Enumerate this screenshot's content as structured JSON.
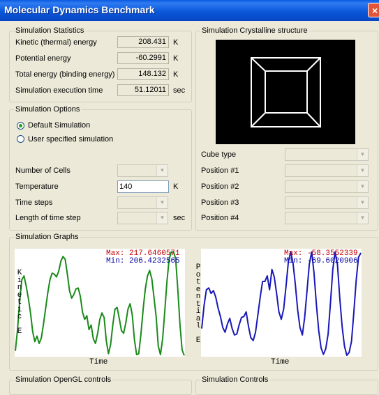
{
  "window": {
    "title": "Molecular Dynamics Benchmark",
    "close_glyph": "×"
  },
  "stats": {
    "legend": "Simulation Statistics",
    "rows": [
      {
        "label": "Kinetic (thermal) energy",
        "value": "208.431",
        "unit": "K"
      },
      {
        "label": "Potential energy",
        "value": "-60.2991",
        "unit": "K"
      },
      {
        "label": "Total energy (binding energy)",
        "value": "148.132",
        "unit": "K"
      },
      {
        "label": "Simulation execution time",
        "value": "51.12011",
        "unit": "sec"
      }
    ]
  },
  "options": {
    "legend": "Simulation Options",
    "default_label": "Default Simulation",
    "user_label": "User specified simulation",
    "cells_label": "Number of Cells",
    "temperature_label": "Temperature",
    "temperature_value": "140",
    "temperature_unit": "K",
    "timesteps_label": "Time steps",
    "length_label": "Length of time step",
    "length_unit": "sec"
  },
  "crystal": {
    "legend": "Simulation Crystalline structure",
    "fields": [
      "Cube type",
      "Position #1",
      "Position #2",
      "Position #3",
      "Position #4"
    ]
  },
  "graphs": {
    "legend": "Simulation Graphs",
    "kinetic": {
      "ylabel": [
        "K",
        "i",
        "n",
        "e",
        "t",
        "i",
        "c",
        "",
        "E"
      ],
      "xlabel": "Time",
      "max_text": "Max: 217.6460571",
      "min_text": "Min: 206.4232565",
      "max": 217.6460571,
      "min": 206.4232565,
      "color": "#1a8a1a",
      "values": [
        206.9,
        209.2,
        212.3,
        214.6,
        215.0,
        213.9,
        212.6,
        211.0,
        209.0,
        207.9,
        208.5,
        207.7,
        208.3,
        209.8,
        211.5,
        213.2,
        214.6,
        215.3,
        215.2,
        214.9,
        215.5,
        216.6,
        217.1,
        216.8,
        215.2,
        213.4,
        212.6,
        213.0,
        213.6,
        213.7,
        212.8,
        211.1,
        210.3,
        210.7,
        209.2,
        209.7,
        208.2,
        207.7,
        208.8,
        210.3,
        211.0,
        210.5,
        208.0,
        206.6,
        207.6,
        209.7,
        211.4,
        211.6,
        210.4,
        209.1,
        208.8,
        209.9,
        211.4,
        212.0,
        210.8,
        208.1,
        206.5,
        206.6,
        208.7,
        211.4,
        213.6,
        215.0,
        215.6,
        214.7,
        212.7,
        210.6,
        207.4,
        206.5,
        208.2,
        211.2,
        214.4,
        216.8,
        217.6,
        217.6,
        216.9,
        213.6,
        209.8,
        207.0,
        206.4
      ]
    },
    "potential": {
      "ylabel": [
        "P",
        "o",
        "t",
        "e",
        "n",
        "t",
        "i",
        "a",
        "l",
        "",
        "E"
      ],
      "xlabel": "Time",
      "max_text": "Max: -58.3552339",
      "min_text": "Min: -69.6020906",
      "max": -58.3552339,
      "min": -69.6020906,
      "color": "#1818b8",
      "values": [
        -66.7,
        -64.2,
        -62.5,
        -62.3,
        -62.9,
        -62.6,
        -63.3,
        -64.5,
        -65.4,
        -66.6,
        -67.1,
        -66.2,
        -65.6,
        -66.7,
        -67.4,
        -67.3,
        -66.3,
        -65.5,
        -65.4,
        -64.9,
        -66.5,
        -67.7,
        -68.0,
        -67.1,
        -65.2,
        -63.3,
        -61.6,
        -61.6,
        -61.0,
        -62.5,
        -60.3,
        -61.1,
        -62.9,
        -64.9,
        -65.7,
        -64.6,
        -62.2,
        -59.5,
        -58.4,
        -59.6,
        -61.9,
        -64.7,
        -66.6,
        -67.4,
        -65.5,
        -62.6,
        -59.7,
        -58.4,
        -60.7,
        -64.1,
        -66.9,
        -68.8,
        -69.5,
        -68.9,
        -67.3,
        -64.0,
        -60.3,
        -58.4,
        -59.8,
        -63.4,
        -66.5,
        -68.6,
        -69.6,
        -69.3,
        -68.1,
        -65.0,
        -61.5,
        -59.0,
        -58.5
      ]
    }
  },
  "bottom": {
    "opengl_legend": "Simulation OpenGL controls",
    "controls_legend": "Simulation Controls"
  }
}
